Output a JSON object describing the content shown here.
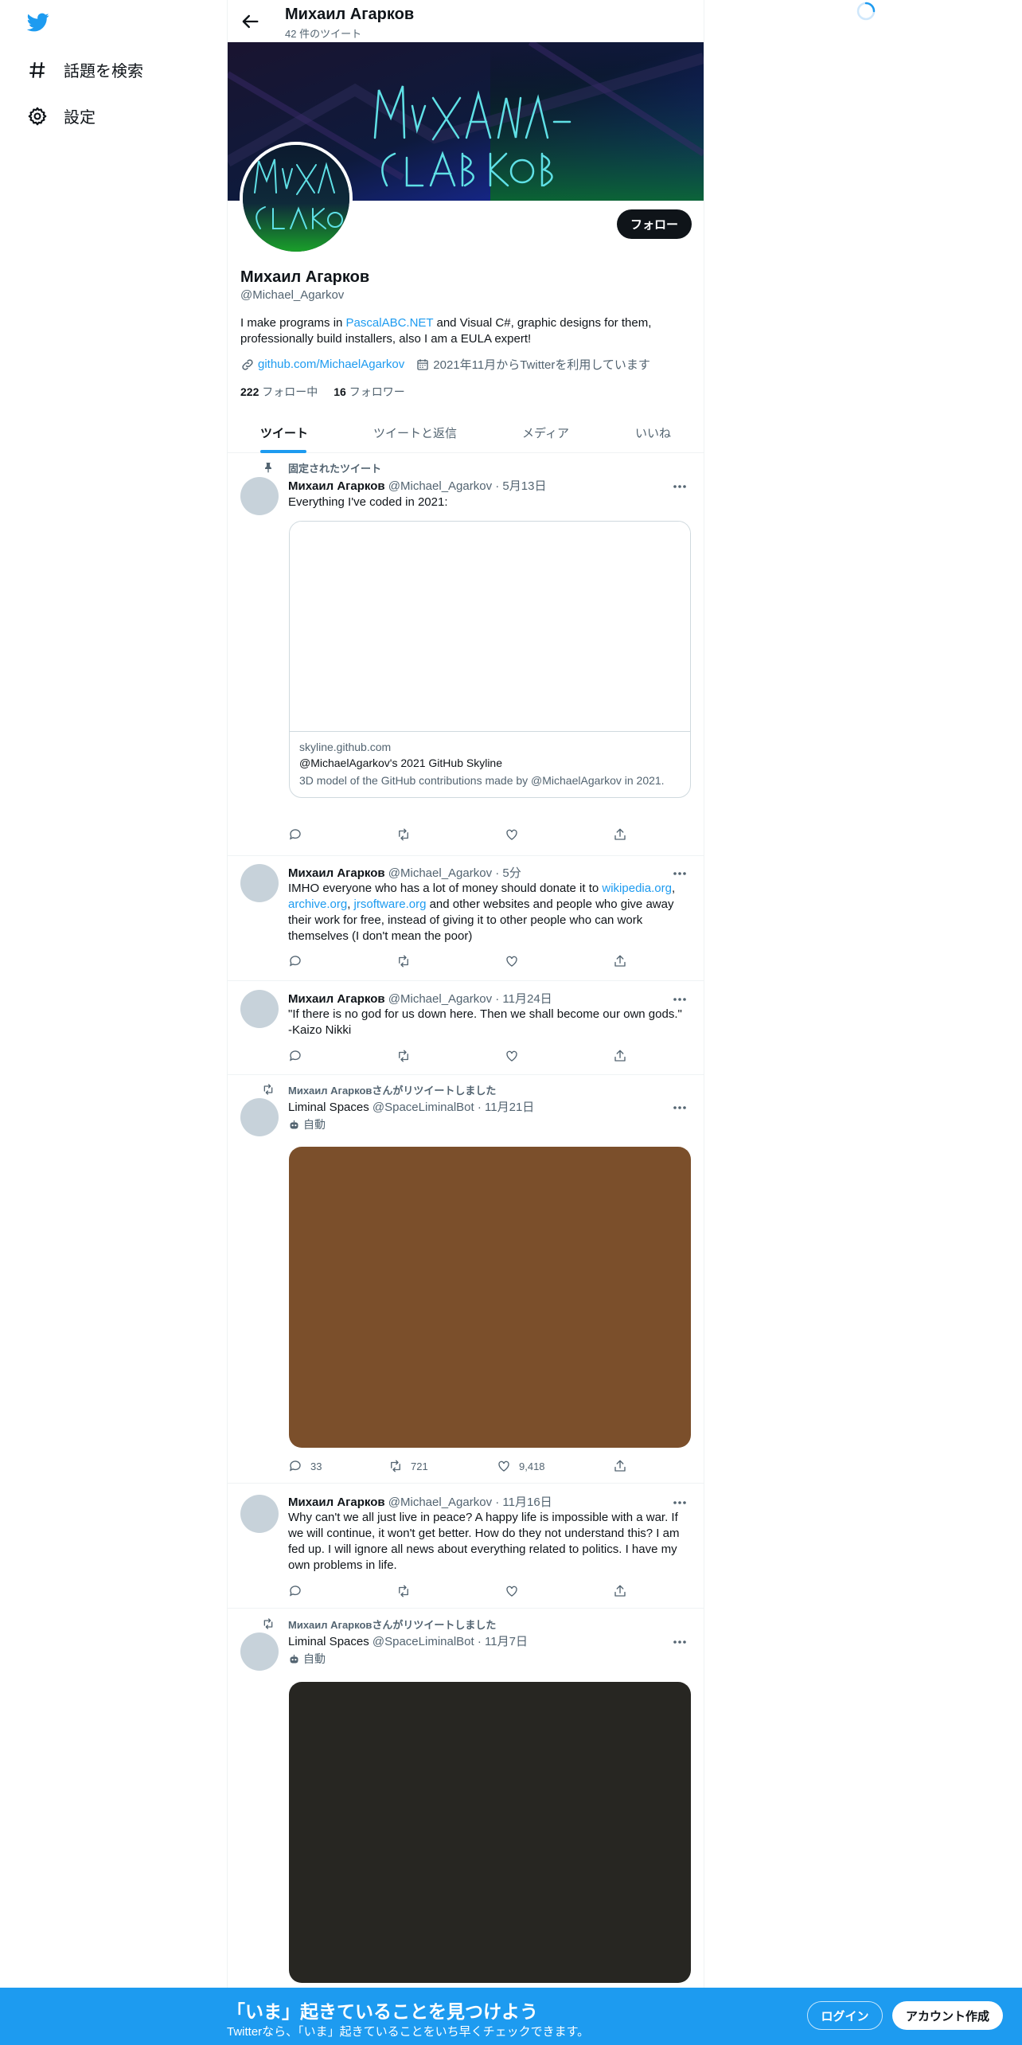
{
  "sidebar": {
    "items": [
      {
        "label": "話題を検索",
        "icon": "hashtag-icon"
      },
      {
        "label": "設定",
        "icon": "gear-icon"
      }
    ]
  },
  "header": {
    "title": "Михаил Агарков",
    "tweet_count": "42 件のツイート"
  },
  "profile": {
    "name": "Михаил Агарков",
    "handle": "@Michael_Agarkov",
    "follow_label": "フォロー",
    "bio": {
      "pre": "I make programs in ",
      "link": "PascalABC.NET",
      "post": " and Visual C#, graphic designs for them, professionally build installers, also I am a EULA expert!"
    },
    "website": "github.com/MichaelAgarkov",
    "joined": "2021年11月からTwitterを利用しています",
    "following_count": "222",
    "following_label": "フォロー中",
    "followers_count": "16",
    "followers_label": "フォロワー"
  },
  "tabs": [
    "ツイート",
    "ツイートと返信",
    "メディア",
    "いいね"
  ],
  "tweets": [
    {
      "pinned_label": "固定されたツイート",
      "name": "Михаил Агарков",
      "handle": "@Michael_Agarkov",
      "date": "5月13日",
      "text": "Everything I've coded in 2021:",
      "card": {
        "domain": "skyline.github.com",
        "title": "@MichaelAgarkov's 2021 GitHub Skyline",
        "description": "3D model of the GitHub contributions made by @MichaelAgarkov in 2021."
      }
    },
    {
      "name": "Михаил Агарков",
      "handle": "@Michael_Agarkov",
      "date": "5分",
      "text_parts": {
        "t1": "IMHO everyone who has a lot of money should donate it to ",
        "l1": "wikipedia.org",
        "t2": ", ",
        "l2": "archive.org",
        "t3": ", ",
        "l3": "jrsoftware.org",
        "t4": " and other websites and people who give away their work for free, instead of giving it to other people who can work themselves (I don't mean the poor)"
      }
    },
    {
      "name": "Михаил Агарков",
      "handle": "@Michael_Agarkov",
      "date": "11月24日",
      "text": "\"If there is no god for us down here. Then we shall become our own gods.\" -Kaizo Nikki"
    },
    {
      "retweeted_by": "Михаил Агарковさんがリツイートしました",
      "name": "Liminal Spaces",
      "handle": "@SpaceLiminalBot",
      "date": "11月21日",
      "auto_label": "自動",
      "media_color": "#7b4f2b",
      "replies": "33",
      "retweets": "721",
      "likes": "9,418"
    },
    {
      "name": "Михаил Агарков",
      "handle": "@Michael_Agarkov",
      "date": "11月16日",
      "text": "Why can't we all just live in peace? A happy life is impossible with a war. If we will continue, it won't get better. How do they not understand this? I am fed up. I will ignore all news about everything related to politics. I have my own problems in life."
    },
    {
      "retweeted_by": "Михаил Агарковさんがリツイートしました",
      "name": "Liminal Spaces",
      "handle": "@SpaceLiminalBot",
      "date": "11月7日",
      "auto_label": "自動",
      "media_color": "#272622"
    }
  ],
  "bottom_banner": {
    "title": "「いま」起きていることを見つけよう",
    "subtitle": "Twitterなら、「いま」起きていることをいち早くチェックできます。",
    "login_label": "ログイン",
    "signup_label": "アカウント作成"
  },
  "colors": {
    "accent": "#1d9bf0",
    "text": "#0f1419",
    "muted": "#536471"
  }
}
